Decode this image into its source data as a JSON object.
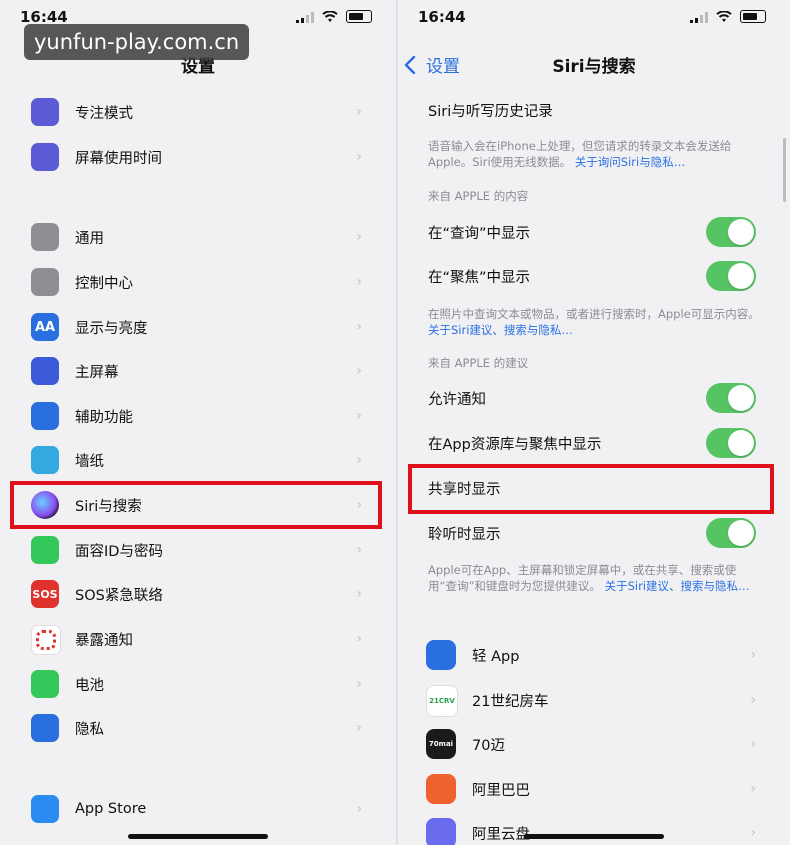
{
  "status": {
    "time": "16:44"
  },
  "watermark": "yunfun-play.com.cn",
  "left": {
    "title": "设置",
    "items": [
      {
        "label": "专注模式",
        "icon": "moon-icon",
        "color": "#5b5bd6"
      },
      {
        "label": "屏幕使用时间",
        "icon": "hourglass-icon",
        "color": "#5b5bd6"
      },
      {
        "label": "通用",
        "icon": "gear-icon",
        "color": "#8e8e93"
      },
      {
        "label": "控制中心",
        "icon": "toggles-icon",
        "color": "#8e8e93"
      },
      {
        "label": "显示与亮度",
        "icon": "text-size-icon",
        "color": "#2a6fe0",
        "glyph": "AA"
      },
      {
        "label": "主屏幕",
        "icon": "grid-icon",
        "color": "#3d5bd9"
      },
      {
        "label": "辅助功能",
        "icon": "accessibility-icon",
        "color": "#2a6fe0"
      },
      {
        "label": "墙纸",
        "icon": "flower-icon",
        "color": "#34a8e0"
      },
      {
        "label": "Siri与搜索",
        "icon": "siri-icon",
        "color": "#222"
      },
      {
        "label": "面容ID与密码",
        "icon": "faceid-icon",
        "color": "#34c759"
      },
      {
        "label": "SOS紧急联络",
        "icon": "sos-icon",
        "color": "#e0322c",
        "glyph": "SOS"
      },
      {
        "label": "暴露通知",
        "icon": "exposure-icon",
        "color": "#ffffff"
      },
      {
        "label": "电池",
        "icon": "battery-icon",
        "color": "#34c759"
      },
      {
        "label": "隐私",
        "icon": "hand-icon",
        "color": "#2a6fe0"
      },
      {
        "label": "App Store",
        "icon": "appstore-icon",
        "color": "#2a8cf0"
      }
    ]
  },
  "right": {
    "back_label": "设置",
    "title": "Siri与搜索",
    "history_label": "Siri与听写历史记录",
    "note1_text": "语音输入会在iPhone上处理，但您请求的转录文本会发送给Apple。Siri使用无线数据。",
    "note1_link": "关于询问Siri与隐私…",
    "section1": "来自 APPLE 的内容",
    "toggle_items_1": [
      {
        "label": "在“查询”中显示"
      },
      {
        "label": "在“聚焦”中显示"
      }
    ],
    "note2_text": "在照片中查询文本或物品，或者进行搜索时，Apple可显示内容。",
    "note2_link": "关于Siri建议、搜索与隐私…",
    "section2": "来自 APPLE 的建议",
    "toggle_items_2": [
      {
        "label": "允许通知"
      },
      {
        "label": "在App资源库与聚焦中显示"
      }
    ],
    "share_label": "共享时显示",
    "listen_label": "聆听时显示",
    "note3_text": "Apple可在App、主屏幕和锁定屏幕中，或在共享、搜索或使用“查询”和键盘时为您提供建议。",
    "note3_link": "关于Siri建议、搜索与隐私…",
    "apps": [
      {
        "label": "轻 App",
        "icon": "light-app-icon",
        "color": "#2a6fe0"
      },
      {
        "label": "21世纪房车",
        "icon": "rv-21-icon",
        "color": "#ffffff",
        "glyph": "21CRV"
      },
      {
        "label": "70迈",
        "icon": "70mai-icon",
        "color": "#1a1a1a",
        "glyph": "70mai"
      },
      {
        "label": "阿里巴巴",
        "icon": "alibaba-icon",
        "color": "#f0622d"
      },
      {
        "label": "阿里云盘",
        "icon": "aliyun-drive-icon",
        "color": "#6a6cf0"
      }
    ]
  }
}
